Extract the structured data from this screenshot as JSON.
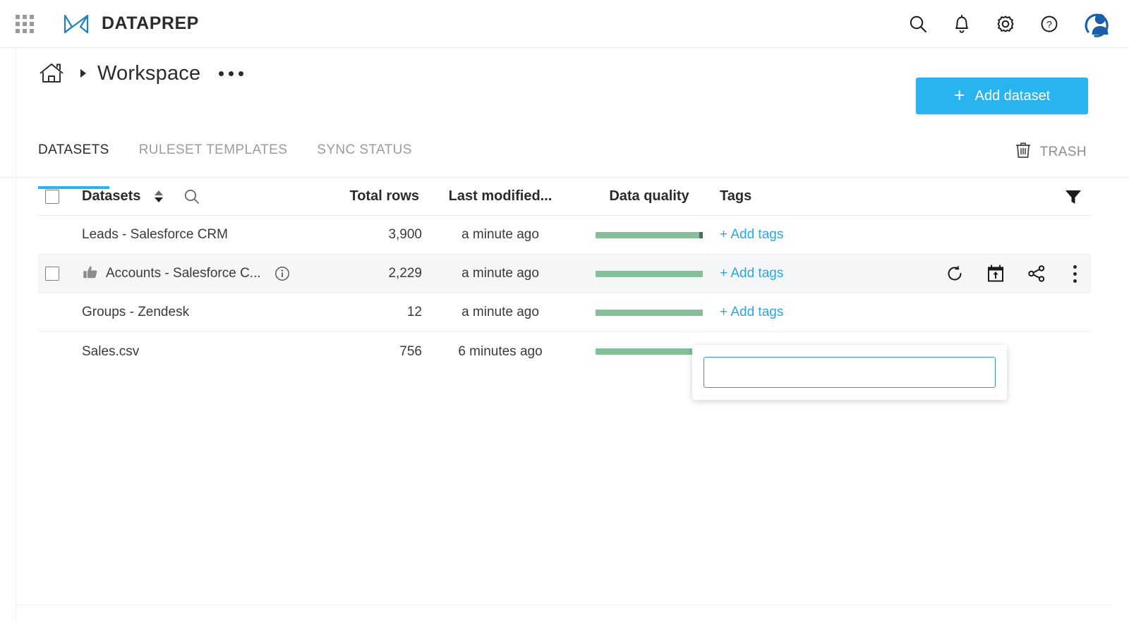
{
  "app": {
    "brand": "DATAPREP",
    "waffle_icon": "grid-apps-icon",
    "logo_icon": "dataprep-logomark"
  },
  "topbar": {
    "icons": [
      {
        "name": "search-icon",
        "label": "Search"
      },
      {
        "name": "bell-icon",
        "label": "Notifications"
      },
      {
        "name": "gear-icon",
        "label": "Settings"
      },
      {
        "name": "help-icon",
        "label": "Help"
      }
    ],
    "avatar": "user-avatar"
  },
  "breadcrumb": {
    "home_icon": "home-icon",
    "separator_icon": "chevron-right-icon",
    "title": "Workspace",
    "more_icon": "ellipsis-icon"
  },
  "actions": {
    "add_dataset": "Add dataset",
    "add_icon": "plus-icon"
  },
  "tabs": [
    {
      "label": "DATASETS",
      "active": true
    },
    {
      "label": "RULESET TEMPLATES",
      "active": false
    },
    {
      "label": "SYNC STATUS",
      "active": false
    }
  ],
  "trash": {
    "label": "TRASH",
    "icon": "trash-icon"
  },
  "table": {
    "headers": {
      "datasets": "Datasets",
      "total_rows": "Total rows",
      "last_modified": "Last modified...",
      "data_quality": "Data quality",
      "tags": "Tags"
    },
    "header_icons": {
      "sort": "sort-arrows-icon",
      "search": "search-icon",
      "filter": "filter-icon"
    },
    "rows": [
      {
        "name": "Leads - Salesforce CRM",
        "total_rows": "3,900",
        "last_modified": "a minute ago",
        "quality_pct": 100,
        "tags_label": "+ Add tags",
        "favorite": false,
        "has_info": false
      },
      {
        "name": "Accounts - Salesforce C...",
        "total_rows": "2,229",
        "last_modified": "a minute ago",
        "quality_pct": 100,
        "tags_label": "+ Add tags",
        "favorite": true,
        "has_info": true
      },
      {
        "name": "Groups - Zendesk",
        "total_rows": "12",
        "last_modified": "a minute ago",
        "quality_pct": 100,
        "tags_label": "+ Add tags",
        "favorite": false,
        "has_info": false
      },
      {
        "name": "Sales.csv",
        "total_rows": "756",
        "last_modified": "6 minutes ago",
        "quality_pct": 100,
        "tags_label": "",
        "favorite": false,
        "has_info": false
      }
    ],
    "row_actions": [
      {
        "name": "sync-icon"
      },
      {
        "name": "schedule-export-icon"
      },
      {
        "name": "share-icon"
      },
      {
        "name": "kebab-menu-icon"
      }
    ]
  },
  "tag_popup": {
    "value": "",
    "placeholder": ""
  },
  "colors": {
    "accent_blue": "#29b3ef",
    "link_blue": "#29a8e0",
    "quality_green": "#85bf9a",
    "text_dark": "#2b2b2b",
    "text_muted": "#9c9c9c"
  }
}
